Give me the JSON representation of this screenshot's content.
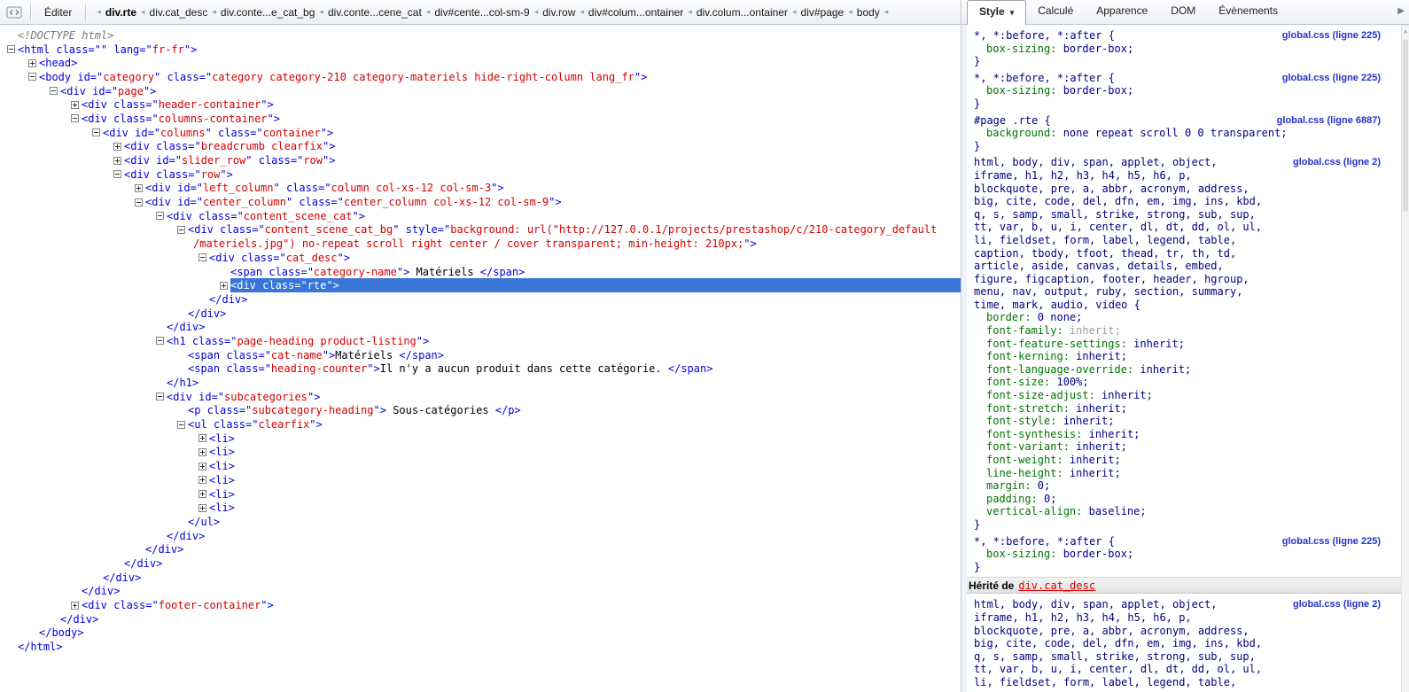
{
  "toolbar": {
    "edit_label": "Éditer",
    "icons": {
      "panel_icon": "html-inspector-icon",
      "tab_overflow": "chevron-right",
      "crumb_separator": "chevron-left"
    },
    "breadcrumb": [
      {
        "label": "div.rte",
        "active": true
      },
      {
        "label": "div.cat_desc",
        "active": false
      },
      {
        "label": "div.conte...e_cat_bg",
        "active": false
      },
      {
        "label": "div.conte...cene_cat",
        "active": false
      },
      {
        "label": "div#cente...col-sm-9",
        "active": false
      },
      {
        "label": "div.row",
        "active": false
      },
      {
        "label": "div#colum...ontainer",
        "active": false
      },
      {
        "label": "div.colum...ontainer",
        "active": false
      },
      {
        "label": "div#page",
        "active": false
      },
      {
        "label": "body",
        "active": false
      }
    ]
  },
  "tabs": [
    {
      "label": "Style",
      "active": true,
      "dropdown": true
    },
    {
      "label": "Calculé",
      "active": false
    },
    {
      "label": "Apparence",
      "active": false
    },
    {
      "label": "DOM",
      "active": false
    },
    {
      "label": "Évènements",
      "active": false
    }
  ],
  "colors": {
    "selection_bg": "#3875d7",
    "markup_blue": "#0000dd",
    "attr_value_red": "#d40000",
    "selector_navy": "#000080",
    "property_green": "#007400",
    "muted_gray": "#9b9b9b",
    "link_blue": "#2233cc"
  },
  "html_tree": {
    "lines": [
      {
        "i": 0,
        "g": "",
        "tok": [
          {
            "c": "d",
            "s": "<!DOCTYPE html>"
          }
        ]
      },
      {
        "i": 0,
        "g": "-",
        "tok": [
          {
            "c": "m",
            "s": "<html class=\"\" lang=\""
          },
          {
            "c": "v",
            "s": "fr-fr"
          },
          {
            "c": "m",
            "s": "\">"
          }
        ]
      },
      {
        "i": 1,
        "g": "+",
        "tok": [
          {
            "c": "m",
            "s": "<head>"
          }
        ]
      },
      {
        "i": 1,
        "g": "-",
        "tok": [
          {
            "c": "m",
            "s": "<body id=\""
          },
          {
            "c": "v",
            "s": "category"
          },
          {
            "c": "m",
            "s": "\" class=\""
          },
          {
            "c": "v",
            "s": "category category-210 category-materiels hide-right-column lang_fr"
          },
          {
            "c": "m",
            "s": "\">"
          }
        ]
      },
      {
        "i": 2,
        "g": "-",
        "tok": [
          {
            "c": "m",
            "s": "<div id=\""
          },
          {
            "c": "v",
            "s": "page"
          },
          {
            "c": "m",
            "s": "\">"
          }
        ]
      },
      {
        "i": 3,
        "g": "+",
        "tok": [
          {
            "c": "m",
            "s": "<div class=\""
          },
          {
            "c": "v",
            "s": "header-container"
          },
          {
            "c": "m",
            "s": "\">"
          }
        ]
      },
      {
        "i": 3,
        "g": "-",
        "tok": [
          {
            "c": "m",
            "s": "<div class=\""
          },
          {
            "c": "v",
            "s": "columns-container"
          },
          {
            "c": "m",
            "s": "\">"
          }
        ]
      },
      {
        "i": 4,
        "g": "-",
        "tok": [
          {
            "c": "m",
            "s": "<div id=\""
          },
          {
            "c": "v",
            "s": "columns"
          },
          {
            "c": "m",
            "s": "\" class=\""
          },
          {
            "c": "v",
            "s": "container"
          },
          {
            "c": "m",
            "s": "\">"
          }
        ]
      },
      {
        "i": 5,
        "g": "+",
        "tok": [
          {
            "c": "m",
            "s": "<div class=\""
          },
          {
            "c": "v",
            "s": "breadcrumb clearfix"
          },
          {
            "c": "m",
            "s": "\">"
          }
        ]
      },
      {
        "i": 5,
        "g": "+",
        "tok": [
          {
            "c": "m",
            "s": "<div id=\""
          },
          {
            "c": "v",
            "s": "slider_row"
          },
          {
            "c": "m",
            "s": "\" class=\""
          },
          {
            "c": "v",
            "s": "row"
          },
          {
            "c": "m",
            "s": "\">"
          }
        ]
      },
      {
        "i": 5,
        "g": "-",
        "tok": [
          {
            "c": "m",
            "s": "<div class=\""
          },
          {
            "c": "v",
            "s": "row"
          },
          {
            "c": "m",
            "s": "\">"
          }
        ]
      },
      {
        "i": 6,
        "g": "+",
        "tok": [
          {
            "c": "m",
            "s": "<div id=\""
          },
          {
            "c": "v",
            "s": "left_column"
          },
          {
            "c": "m",
            "s": "\" class=\""
          },
          {
            "c": "v",
            "s": "column col-xs-12 col-sm-3"
          },
          {
            "c": "m",
            "s": "\">"
          }
        ]
      },
      {
        "i": 6,
        "g": "-",
        "tok": [
          {
            "c": "m",
            "s": "<div id=\""
          },
          {
            "c": "v",
            "s": "center_column"
          },
          {
            "c": "m",
            "s": "\" class=\""
          },
          {
            "c": "v",
            "s": "center_column col-xs-12 col-sm-9"
          },
          {
            "c": "m",
            "s": "\">"
          }
        ]
      },
      {
        "i": 7,
        "g": "-",
        "tok": [
          {
            "c": "m",
            "s": "<div class=\""
          },
          {
            "c": "v",
            "s": "content_scene_cat"
          },
          {
            "c": "m",
            "s": "\">"
          }
        ]
      },
      {
        "i": 8,
        "g": "-",
        "tok": [
          {
            "c": "m",
            "s": "<div class=\""
          },
          {
            "c": "v",
            "s": "content_scene_cat_bg"
          },
          {
            "c": "m",
            "s": "\" style=\""
          },
          {
            "c": "v",
            "s": "background: url(\"http://127.0.0.1/projects/prestashop/c/210-category_default"
          }
        ]
      },
      {
        "i": 8,
        "g": "",
        "cont": true,
        "tok": [
          {
            "c": "v",
            "s": "/materiels.jpg\") no-repeat scroll right center / cover transparent; min-height: 210px;"
          },
          {
            "c": "m",
            "s": "\">"
          }
        ]
      },
      {
        "i": 9,
        "g": "-",
        "tok": [
          {
            "c": "m",
            "s": "<div class=\""
          },
          {
            "c": "v",
            "s": "cat_desc"
          },
          {
            "c": "m",
            "s": "\">"
          }
        ]
      },
      {
        "i": 10,
        "g": "",
        "tok": [
          {
            "c": "m",
            "s": "<span class=\""
          },
          {
            "c": "v",
            "s": "category-name"
          },
          {
            "c": "m",
            "s": "\">"
          },
          {
            "c": "t",
            "s": " Matériels "
          },
          {
            "c": "m",
            "s": "</span>"
          }
        ]
      },
      {
        "i": 10,
        "g": "+",
        "sel": true,
        "tok": [
          {
            "c": "m",
            "s": "<div class=\""
          },
          {
            "c": "v",
            "s": "rte"
          },
          {
            "c": "m",
            "s": "\">"
          }
        ]
      },
      {
        "i": 9,
        "g": "",
        "tok": [
          {
            "c": "m",
            "s": "</div>"
          }
        ]
      },
      {
        "i": 8,
        "g": "",
        "tok": [
          {
            "c": "m",
            "s": "</div>"
          }
        ]
      },
      {
        "i": 7,
        "g": "",
        "tok": [
          {
            "c": "m",
            "s": "</div>"
          }
        ]
      },
      {
        "i": 7,
        "g": "-",
        "tok": [
          {
            "c": "m",
            "s": "<h1 class=\""
          },
          {
            "c": "v",
            "s": "page-heading product-listing"
          },
          {
            "c": "m",
            "s": "\">"
          }
        ]
      },
      {
        "i": 8,
        "g": "",
        "tok": [
          {
            "c": "m",
            "s": "<span class=\""
          },
          {
            "c": "v",
            "s": "cat-name"
          },
          {
            "c": "m",
            "s": "\">"
          },
          {
            "c": "t",
            "s": "Matériels "
          },
          {
            "c": "m",
            "s": "</span>"
          }
        ]
      },
      {
        "i": 8,
        "g": "",
        "tok": [
          {
            "c": "m",
            "s": "<span class=\""
          },
          {
            "c": "v",
            "s": "heading-counter"
          },
          {
            "c": "m",
            "s": "\">"
          },
          {
            "c": "t",
            "s": "Il n'y a aucun produit dans cette catégorie. "
          },
          {
            "c": "m",
            "s": "</span>"
          }
        ]
      },
      {
        "i": 7,
        "g": "",
        "tok": [
          {
            "c": "m",
            "s": "</h1>"
          }
        ]
      },
      {
        "i": 7,
        "g": "-",
        "tok": [
          {
            "c": "m",
            "s": "<div id=\""
          },
          {
            "c": "v",
            "s": "subcategories"
          },
          {
            "c": "m",
            "s": "\">"
          }
        ]
      },
      {
        "i": 8,
        "g": "",
        "tok": [
          {
            "c": "m",
            "s": "<p class=\""
          },
          {
            "c": "v",
            "s": "subcategory-heading"
          },
          {
            "c": "m",
            "s": "\">"
          },
          {
            "c": "t",
            "s": " Sous-catégories "
          },
          {
            "c": "m",
            "s": "</p>"
          }
        ]
      },
      {
        "i": 8,
        "g": "-",
        "tok": [
          {
            "c": "m",
            "s": "<ul class=\""
          },
          {
            "c": "v",
            "s": "clearfix"
          },
          {
            "c": "m",
            "s": "\">"
          }
        ]
      },
      {
        "i": 9,
        "g": "+",
        "tok": [
          {
            "c": "m",
            "s": "<li>"
          }
        ]
      },
      {
        "i": 9,
        "g": "+",
        "tok": [
          {
            "c": "m",
            "s": "<li>"
          }
        ]
      },
      {
        "i": 9,
        "g": "+",
        "tok": [
          {
            "c": "m",
            "s": "<li>"
          }
        ]
      },
      {
        "i": 9,
        "g": "+",
        "tok": [
          {
            "c": "m",
            "s": "<li>"
          }
        ]
      },
      {
        "i": 9,
        "g": "+",
        "tok": [
          {
            "c": "m",
            "s": "<li>"
          }
        ]
      },
      {
        "i": 9,
        "g": "+",
        "tok": [
          {
            "c": "m",
            "s": "<li>"
          }
        ]
      },
      {
        "i": 8,
        "g": "",
        "tok": [
          {
            "c": "m",
            "s": "</ul>"
          }
        ]
      },
      {
        "i": 7,
        "g": "",
        "tok": [
          {
            "c": "m",
            "s": "</div>"
          }
        ]
      },
      {
        "i": 6,
        "g": "",
        "tok": [
          {
            "c": "m",
            "s": "</div>"
          }
        ]
      },
      {
        "i": 5,
        "g": "",
        "tok": [
          {
            "c": "m",
            "s": "</div>"
          }
        ]
      },
      {
        "i": 4,
        "g": "",
        "tok": [
          {
            "c": "m",
            "s": "</div>"
          }
        ]
      },
      {
        "i": 3,
        "g": "",
        "tok": [
          {
            "c": "m",
            "s": "</div>"
          }
        ]
      },
      {
        "i": 3,
        "g": "+",
        "tok": [
          {
            "c": "m",
            "s": "<div class=\""
          },
          {
            "c": "v",
            "s": "footer-container"
          },
          {
            "c": "m",
            "s": "\">"
          }
        ]
      },
      {
        "i": 2,
        "g": "",
        "tok": [
          {
            "c": "m",
            "s": "</div>"
          }
        ]
      },
      {
        "i": 1,
        "g": "",
        "tok": [
          {
            "c": "m",
            "s": "</body>"
          }
        ]
      },
      {
        "i": 0,
        "g": "",
        "tok": [
          {
            "c": "m",
            "s": "</html>"
          }
        ]
      }
    ]
  },
  "style_panel": {
    "rules": [
      {
        "selector": [
          "*, *:before, *:after {"
        ],
        "decls": [
          {
            "p": "box-sizing",
            "v": "border-box"
          }
        ],
        "link": "global.css (ligne 225)"
      },
      {
        "selector": [
          "*, *:before, *:after {"
        ],
        "decls": [
          {
            "p": "box-sizing",
            "v": "border-box"
          }
        ],
        "link": "global.css (ligne 225)"
      },
      {
        "selector": [
          "#page .rte {"
        ],
        "decls": [
          {
            "p": "background",
            "v": "none repeat scroll 0 0 transparent"
          }
        ],
        "link": "global.css (ligne 6887)"
      },
      {
        "selector": [
          "html, body, div, span, applet, object,",
          "iframe, h1, h2, h3, h4, h5, h6, p,",
          "blockquote, pre, a, abbr, acronym, address,",
          "big, cite, code, del, dfn, em, img, ins, kbd,",
          "q, s, samp, small, strike, strong, sub, sup,",
          "tt, var, b, u, i, center, dl, dt, dd, ol, ul,",
          "li, fieldset, form, label, legend, table,",
          "caption, tbody, tfoot, thead, tr, th, td,",
          "article, aside, canvas, details, embed,",
          "figure, figcaption, footer, header, hgroup,",
          "menu, nav, output, ruby, section, summary,",
          "time, mark, audio, video {"
        ],
        "decls": [
          {
            "p": "border",
            "v": "0 none"
          },
          {
            "p": "font-family",
            "v": "inherit",
            "muted": true
          },
          {
            "p": "font-feature-settings",
            "v": "inherit"
          },
          {
            "p": "font-kerning",
            "v": "inherit"
          },
          {
            "p": "font-language-override",
            "v": "inherit"
          },
          {
            "p": "font-size",
            "v": "100%"
          },
          {
            "p": "font-size-adjust",
            "v": "inherit"
          },
          {
            "p": "font-stretch",
            "v": "inherit"
          },
          {
            "p": "font-style",
            "v": "inherit"
          },
          {
            "p": "font-synthesis",
            "v": "inherit"
          },
          {
            "p": "font-variant",
            "v": "inherit"
          },
          {
            "p": "font-weight",
            "v": "inherit"
          },
          {
            "p": "line-height",
            "v": "inherit"
          },
          {
            "p": "margin",
            "v": "0"
          },
          {
            "p": "padding",
            "v": "0"
          },
          {
            "p": "vertical-align",
            "v": "baseline"
          }
        ],
        "link": "global.css (ligne 2)"
      },
      {
        "selector": [
          "*, *:before, *:after {"
        ],
        "decls": [
          {
            "p": "box-sizing",
            "v": "border-box"
          }
        ],
        "link": "global.css (ligne 225)"
      }
    ],
    "inherited": {
      "label": "Hérité de",
      "element": "div.cat_desc",
      "rules": [
        {
          "selector": [
            "html, body, div, span, applet, object,",
            "iframe, h1, h2, h3, h4, h5, h6, p,",
            "blockquote, pre, a, abbr, acronym, address,",
            "big, cite, code, del, dfn, em, img, ins, kbd,",
            "q, s, samp, small, strike, strong, sub, sup,",
            "tt, var, b, u, i, center, dl, dt, dd, ol, ul,",
            "li, fieldset, form, label, legend, table,"
          ],
          "decls": [],
          "truncated": true,
          "link": "global.css (ligne 2)"
        }
      ]
    }
  }
}
